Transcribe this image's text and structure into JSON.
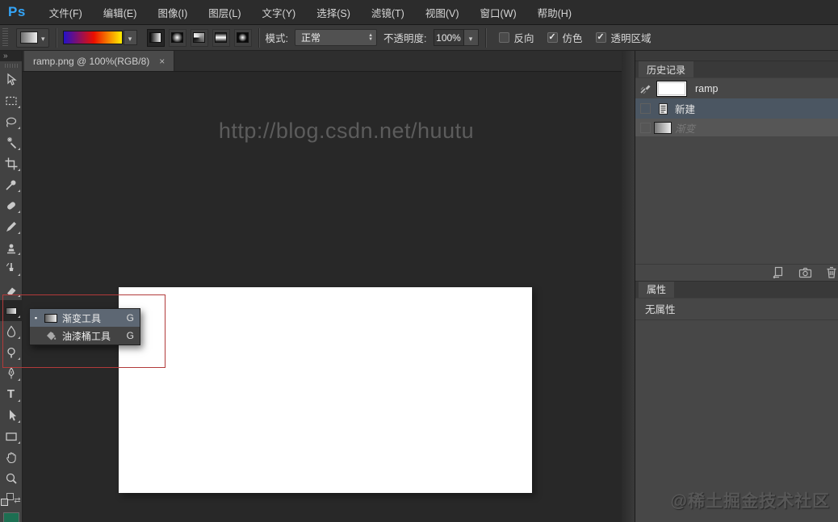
{
  "app": {
    "logo_text": "Ps"
  },
  "menubar": {
    "items": [
      "文件(F)",
      "编辑(E)",
      "图像(I)",
      "图层(L)",
      "文字(Y)",
      "选择(S)",
      "滤镜(T)",
      "视图(V)",
      "窗口(W)",
      "帮助(H)"
    ]
  },
  "optionsbar": {
    "mode_label": "模式:",
    "mode_value": "正常",
    "opacity_label": "不透明度:",
    "opacity_value": "100%",
    "checkbox_reverse": {
      "label": "反向",
      "checked": false,
      "glyph": ""
    },
    "checkbox_dither": {
      "label": "仿色",
      "checked": true,
      "glyph": "✓"
    },
    "checkbox_transparency": {
      "label": "透明区域",
      "checked": true,
      "glyph": "✓"
    },
    "gradient_preview_colors": [
      "#2411c8",
      "#ec0f00",
      "#ffee00"
    ],
    "gradient_type_icons": [
      "linear-gradient-icon",
      "radial-gradient-icon",
      "angle-gradient-icon",
      "reflected-gradient-icon",
      "diamond-gradient-icon"
    ],
    "selected_gradient_type": "linear"
  },
  "document": {
    "tab_title": "ramp.png @ 100%(RGB/8)",
    "close_glyph": "×",
    "canvas_watermark": "http://blog.csdn.net/huutu"
  },
  "toolbar": {
    "tools": [
      "move-tool",
      "rectangular-marquee-tool",
      "lasso-tool",
      "magic-wand-tool",
      "crop-tool",
      "eyedropper-tool",
      "healing-brush-tool",
      "brush-tool",
      "clone-stamp-tool",
      "history-brush-tool",
      "eraser-tool",
      "gradient-tool",
      "blur-tool",
      "dodge-tool",
      "pen-tool",
      "type-tool",
      "path-selection-tool",
      "rectangle-tool",
      "hand-tool",
      "zoom-tool"
    ],
    "selected_tool": "gradient-tool",
    "foreground_color": "#1d6f52"
  },
  "tool_flyout": {
    "items": [
      {
        "bullet": "▪",
        "label": "渐变工具",
        "shortcut": "G",
        "selected": true
      },
      {
        "bullet": "",
        "label": "油漆桶工具",
        "shortcut": "G",
        "selected": false
      }
    ]
  },
  "history_panel": {
    "tab": "历史记录",
    "snapshot_label": "ramp",
    "states": [
      {
        "label": "新建",
        "status": "selected"
      },
      {
        "label": "渐变",
        "status": "undone"
      }
    ],
    "bottom_icons": [
      "new-document-from-state-icon",
      "new-snapshot-icon",
      "delete-state-icon"
    ]
  },
  "properties_panel": {
    "tab": "属性",
    "empty_text": "无属性"
  },
  "site_watermark": "@稀土掘金技术社区",
  "accent_colors": {
    "logo_blue": "#34a5f8",
    "selected_state_bg": "#4b5662",
    "annotation_red": "#b23a3a"
  }
}
